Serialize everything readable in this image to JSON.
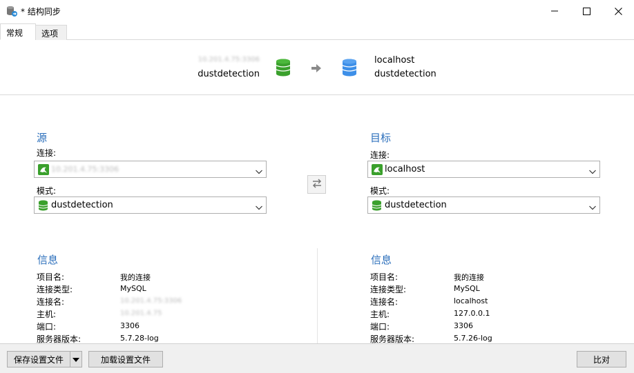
{
  "window": {
    "title": "* 结构同步"
  },
  "tabs": [
    {
      "label": "常规",
      "active": true
    },
    {
      "label": "选项",
      "active": false
    }
  ],
  "summary": {
    "source_host": "10.201.4.75:3306",
    "source_db": "dustdetection",
    "target_host": "localhost",
    "target_db": "dustdetection"
  },
  "source": {
    "heading": "源",
    "connection_label": "连接:",
    "connection_value": "10.201.4.75:3306",
    "schema_label": "模式:",
    "schema_value": "dustdetection"
  },
  "target": {
    "heading": "目标",
    "connection_label": "连接:",
    "connection_value": "localhost",
    "schema_label": "模式:",
    "schema_value": "dustdetection"
  },
  "source_info": {
    "heading": "信息",
    "rows": [
      {
        "key": "项目名:",
        "value": "我的连接"
      },
      {
        "key": "连接类型:",
        "value": "MySQL"
      },
      {
        "key": "连接名:",
        "value": "10.201.4.75:3306"
      },
      {
        "key": "主机:",
        "value": "10.201.4.75"
      },
      {
        "key": "端口:",
        "value": "3306"
      },
      {
        "key": "服务器版本:",
        "value": "5.7.28-log"
      }
    ]
  },
  "target_info": {
    "heading": "信息",
    "rows": [
      {
        "key": "项目名:",
        "value": "我的连接"
      },
      {
        "key": "连接类型:",
        "value": "MySQL"
      },
      {
        "key": "连接名:",
        "value": "localhost"
      },
      {
        "key": "主机:",
        "value": "127.0.0.1"
      },
      {
        "key": "端口:",
        "value": "3306"
      },
      {
        "key": "服务器版本:",
        "value": "5.7.26-log"
      }
    ]
  },
  "bottom": {
    "save_profile": "保存设置文件",
    "load_profile": "加载设置文件",
    "compare": "比对"
  },
  "colors": {
    "accent_heading": "#2a6ebb",
    "db_green": "#3aa02c",
    "db_blue": "#3d8fe8"
  }
}
